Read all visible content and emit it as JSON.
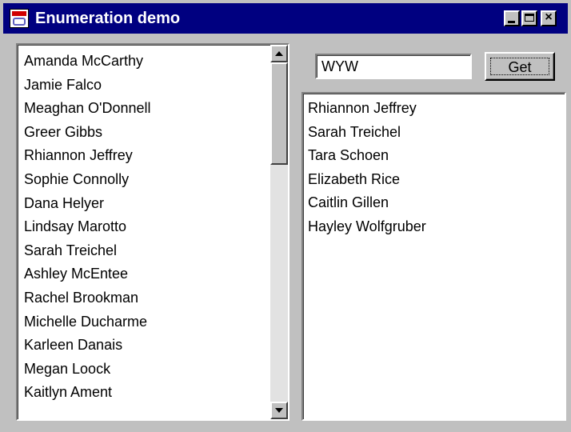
{
  "window": {
    "title": "Enumeration demo",
    "controls": {
      "minimize": "_",
      "maximize": "□",
      "close": "×"
    }
  },
  "left_list": {
    "items": [
      "Amanda McCarthy",
      "Jamie Falco",
      "Meaghan O'Donnell",
      "Greer Gibbs",
      "Rhiannon Jeffrey",
      "Sophie Connolly",
      "Dana Helyer",
      "Lindsay Marotto",
      "Sarah Treichel",
      "Ashley McEntee",
      "Rachel Brookman",
      "Michelle Ducharme",
      "Karleen Danais",
      "Megan Loock",
      "Kaitlyn Ament"
    ]
  },
  "search": {
    "value": "WYW",
    "button_label": "Get"
  },
  "results": {
    "items": [
      "Rhiannon Jeffrey",
      "Sarah Treichel",
      "Tara Schoen",
      "Elizabeth Rice",
      "Caitlin Gillen",
      "Hayley Wolfgruber"
    ]
  },
  "colors": {
    "titlebar": "#000080",
    "face": "#c0c0c0",
    "list_bg": "#ffffff"
  }
}
